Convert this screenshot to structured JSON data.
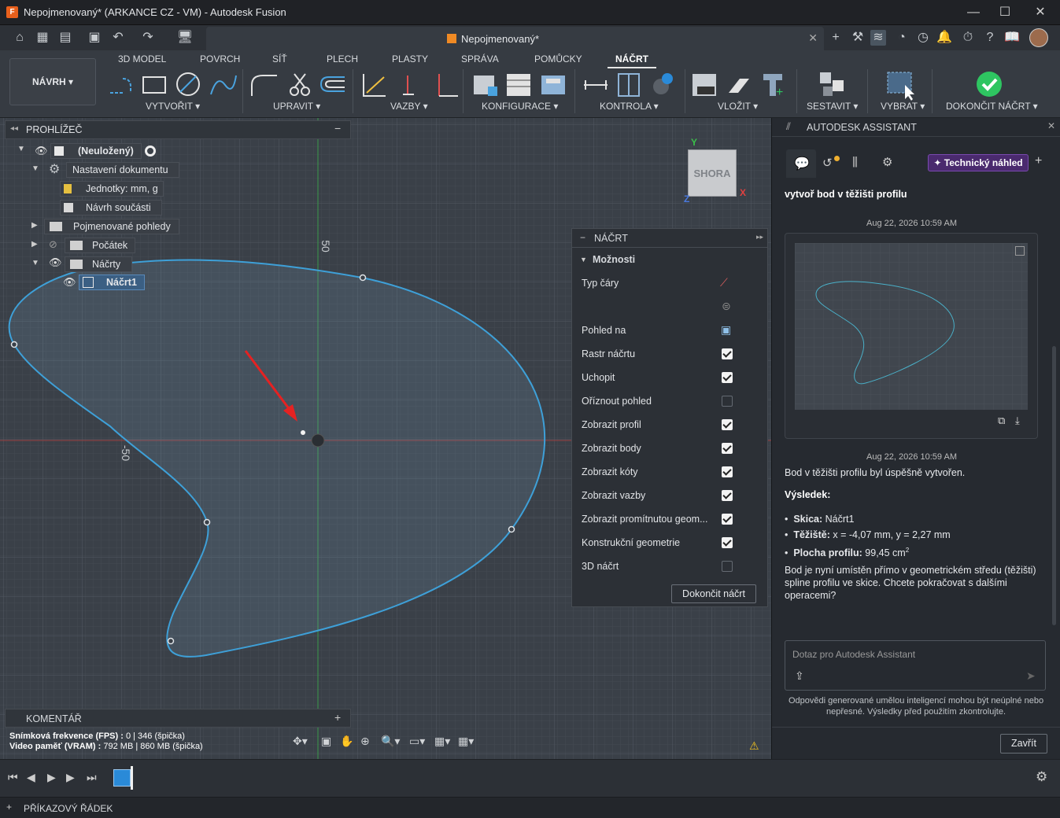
{
  "window": {
    "title": "Nepojmenovaný* (ARKANCE CZ - VM) - Autodesk Fusion",
    "logo": "F"
  },
  "document_tab": {
    "title": "Nepojmenovaný*"
  },
  "workspace": {
    "label": "NÁVRH ▾"
  },
  "ribbon": {
    "tabs": [
      "3D MODEL",
      "POVRCH",
      "SÍŤ",
      "PLECH",
      "PLASTY",
      "SPRÁVA",
      "POMŮCKY",
      "NÁČRT"
    ],
    "groups": [
      "VYTVOŘIT ▾",
      "UPRAVIT ▾",
      "VAZBY ▾",
      "KONFIGURACE ▾",
      "KONTROLA ▾",
      "VLOŽIT ▾",
      "SESTAVIT ▾",
      "VYBRAT ▾",
      "DOKONČIT NÁČRT ▾"
    ]
  },
  "browser": {
    "title": "PROHLÍŽEČ",
    "items": [
      {
        "label": "(Neuložený)"
      },
      {
        "label": "Nastavení dokumentu"
      },
      {
        "label": "Jednotky: mm, g"
      },
      {
        "label": "Návrh součásti"
      },
      {
        "label": "Pojmenované pohledy"
      },
      {
        "label": "Počátek"
      },
      {
        "label": "Náčrty"
      },
      {
        "label": "Náčrt1"
      }
    ]
  },
  "viewcube": {
    "face": "SHORA",
    "axis_y": "Y",
    "axis_x": "X",
    "axis_z": "Z"
  },
  "canvas": {
    "dim_top": "50",
    "dim_left": "-50"
  },
  "comment": {
    "title": "KOMENTÁŘ",
    "add": "+"
  },
  "stats": {
    "fps_label": "Snímková frekvence (FPS) :",
    "fps_value": " 0 | 346 (špička)",
    "vram_label": "Video paměť (VRAM) :",
    "vram_value": " 792 MB | 860 MB (špička)"
  },
  "sketch_palette": {
    "title": "NÁČRT",
    "section": "Možnosti",
    "rows": [
      {
        "label": "Typ čáry"
      },
      {
        "label": "Pohled na"
      },
      {
        "label": "Rastr náčrtu",
        "checked": true
      },
      {
        "label": "Uchopit",
        "checked": true
      },
      {
        "label": "Oříznout pohled",
        "checked": false
      },
      {
        "label": "Zobrazit profil",
        "checked": true
      },
      {
        "label": "Zobrazit body",
        "checked": true
      },
      {
        "label": "Zobrazit kóty",
        "checked": true
      },
      {
        "label": "Zobrazit vazby",
        "checked": true
      },
      {
        "label": "Zobrazit promítnutou geom...",
        "checked": true
      },
      {
        "label": "Konstrukční geometrie",
        "checked": true
      },
      {
        "label": "3D náčrt",
        "checked": false
      }
    ],
    "finish_button": "Dokončit náčrt"
  },
  "assistant": {
    "title": "AUTODESK ASSISTANT",
    "badge": "Technický náhled",
    "user_message": "vytvoř bod v těžišti profilu",
    "timestamp1": "Aug 22, 2026 10:59 AM",
    "timestamp2": "Aug 22, 2026 10:59 AM",
    "reply_intro": "Bod v těžišti profilu byl úspěšně vytvořen.",
    "result_heading": "Výsledek:",
    "bullets": [
      {
        "key": "Skica:",
        "value": " Náčrt1"
      },
      {
        "key": "Těžiště:",
        "value": " x = -4,07 mm, y = 2,27 mm"
      },
      {
        "key": "Plocha profilu:",
        "value": " 99,45 cm"
      }
    ],
    "area_sup": "2",
    "reply_outro": "Bod je nyní umístěn přímo v geometrickém středu (těžišti) spline profilu ve skice. Chcete pokračovat s dalšími operacemi?",
    "input_placeholder": "Dotaz pro Autodesk Assistant",
    "disclaimer": "Odpovědi generované umělou inteligencí mohou být neúplné nebo nepřesné. Výsledky před použitím zkontrolujte.",
    "close_button": "Zavřít"
  },
  "command_line": {
    "label": "PŘÍKAZOVÝ ŘÁDEK",
    "expander": "+"
  },
  "colors": {
    "accent": "#4aa3df",
    "spline": "#3ea0d8",
    "check": "#2ec561"
  }
}
